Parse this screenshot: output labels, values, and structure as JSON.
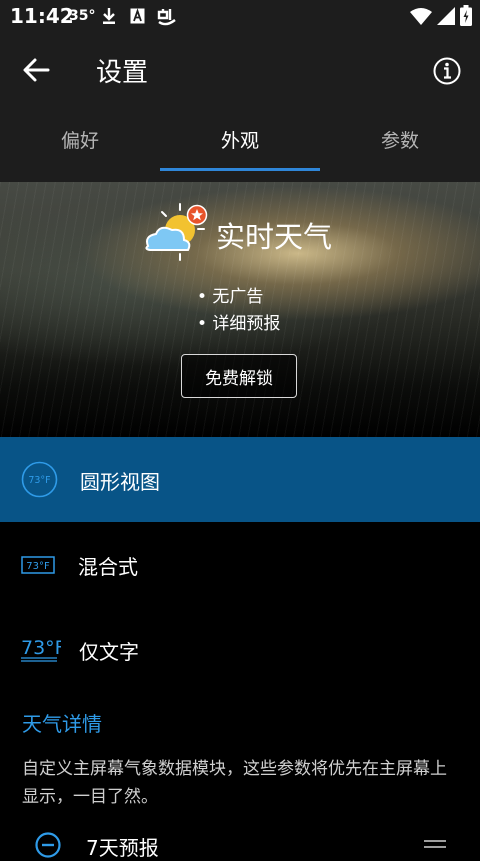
{
  "status_bar": {
    "time": "11:42",
    "temperature": "35°",
    "icons": [
      "download-icon",
      "a-box-icon",
      "bug-icon",
      "wifi-icon",
      "signal-icon",
      "battery-icon"
    ]
  },
  "app_bar": {
    "title": "设置",
    "back_icon": "arrow-back-icon",
    "info_icon": "info-icon"
  },
  "tabs": [
    {
      "label": "偏好",
      "active": false
    },
    {
      "label": "外观",
      "active": true
    },
    {
      "label": "参数",
      "active": false
    }
  ],
  "banner": {
    "title": "实时天气",
    "features": [
      "• 无广告",
      "• 详细预报"
    ],
    "unlock_button": "免费解锁"
  },
  "display_options": [
    {
      "label": "圆形视图",
      "icon_text": "73°F",
      "icon": "circle-temp-icon",
      "selected": true
    },
    {
      "label": "混合式",
      "icon_text": "73°F",
      "icon": "box-temp-icon",
      "selected": false
    },
    {
      "label": "仅文字",
      "icon_text": "73°F",
      "icon": "text-temp-icon",
      "selected": false
    }
  ],
  "weather_details": {
    "header": "天气详情",
    "description": "自定义主屏幕气象数据模块，这些参数将优先在主屏幕上显示，一目了然。",
    "items": [
      {
        "label": "7天预报",
        "icon": "remove-circle-icon",
        "handle_icon": "drag-handle-icon"
      }
    ]
  },
  "colors": {
    "accent": "#2F86D8",
    "selected_row": "#085487",
    "header_text": "#2F9BE8",
    "bar_background": "#1D1D1D"
  }
}
